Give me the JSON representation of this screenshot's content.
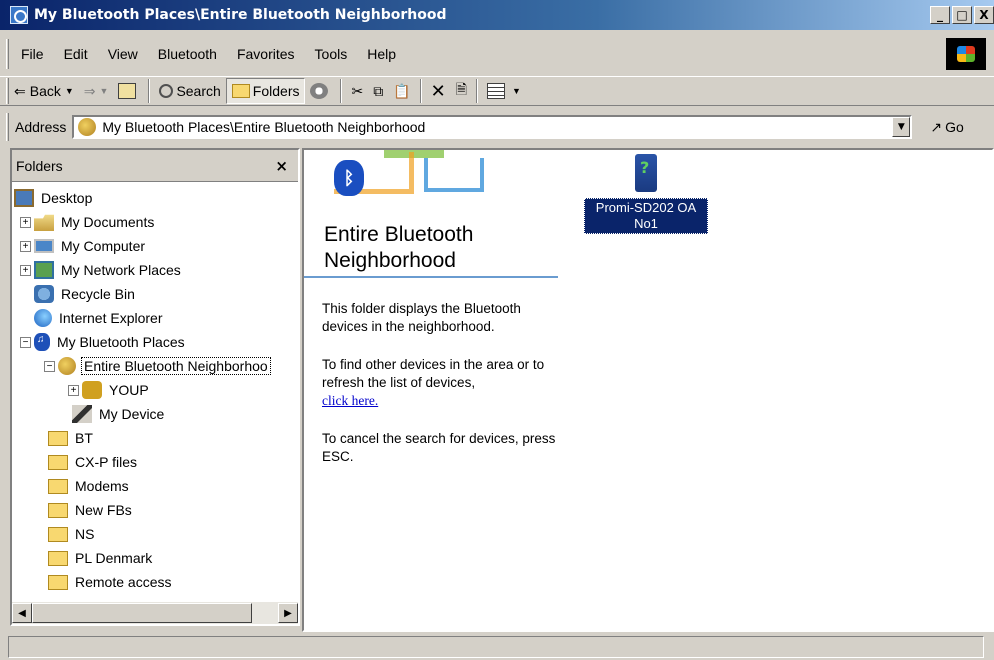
{
  "window": {
    "title": "My Bluetooth Places\\Entire Bluetooth Neighborhood",
    "minimize": "_",
    "maximize": "□",
    "close": "X"
  },
  "menu": {
    "items": [
      "File",
      "Edit",
      "View",
      "Bluetooth",
      "Favorites",
      "Tools",
      "Help"
    ]
  },
  "toolbar": {
    "back_label": "Back",
    "search_label": "Search",
    "folders_label": "Folders"
  },
  "address": {
    "label": "Address",
    "value": "My Bluetooth Places\\Entire Bluetooth Neighborhood",
    "go_label": "Go"
  },
  "folders_pane": {
    "title": "Folders",
    "close": "×",
    "tree": [
      {
        "label": "Desktop",
        "icon": "desktop-icon"
      },
      {
        "label": "My Documents",
        "icon": "documents-icon"
      },
      {
        "label": "My Computer",
        "icon": "computer-icon"
      },
      {
        "label": "My Network Places",
        "icon": "network-icon"
      },
      {
        "label": "Recycle Bin",
        "icon": "recycle-bin-icon"
      },
      {
        "label": "Internet Explorer",
        "icon": "internet-explorer-icon"
      },
      {
        "label": "My Bluetooth Places",
        "icon": "bluetooth-icon"
      },
      {
        "label": "Entire Bluetooth Neighborhoo",
        "icon": "neighborhood-icon"
      },
      {
        "label": "YOUP",
        "icon": "device-unknown-icon"
      },
      {
        "label": "My Device",
        "icon": "my-device-icon"
      },
      {
        "label": "BT",
        "icon": "folder-icon"
      },
      {
        "label": "CX-P files",
        "icon": "folder-icon"
      },
      {
        "label": "Modems",
        "icon": "folder-icon"
      },
      {
        "label": "New FBs",
        "icon": "folder-icon"
      },
      {
        "label": "NS",
        "icon": "folder-icon"
      },
      {
        "label": "PL Denmark",
        "icon": "folder-icon"
      },
      {
        "label": "Remote access",
        "icon": "folder-icon"
      }
    ]
  },
  "main": {
    "heading": "Entire Bluetooth Neighborhood",
    "desc1": "This folder displays the Bluetooth devices in the neighborhood.",
    "desc2": "To find other devices in the area or to refresh the list of devices,",
    "link": "click here.",
    "desc3": "To cancel the search for devices, press ESC.",
    "device_label": "Promi-SD202 OA No1"
  },
  "colors": {
    "selection": "#0a246a",
    "link": "#0000cc",
    "chrome": "#d4d0c8"
  }
}
